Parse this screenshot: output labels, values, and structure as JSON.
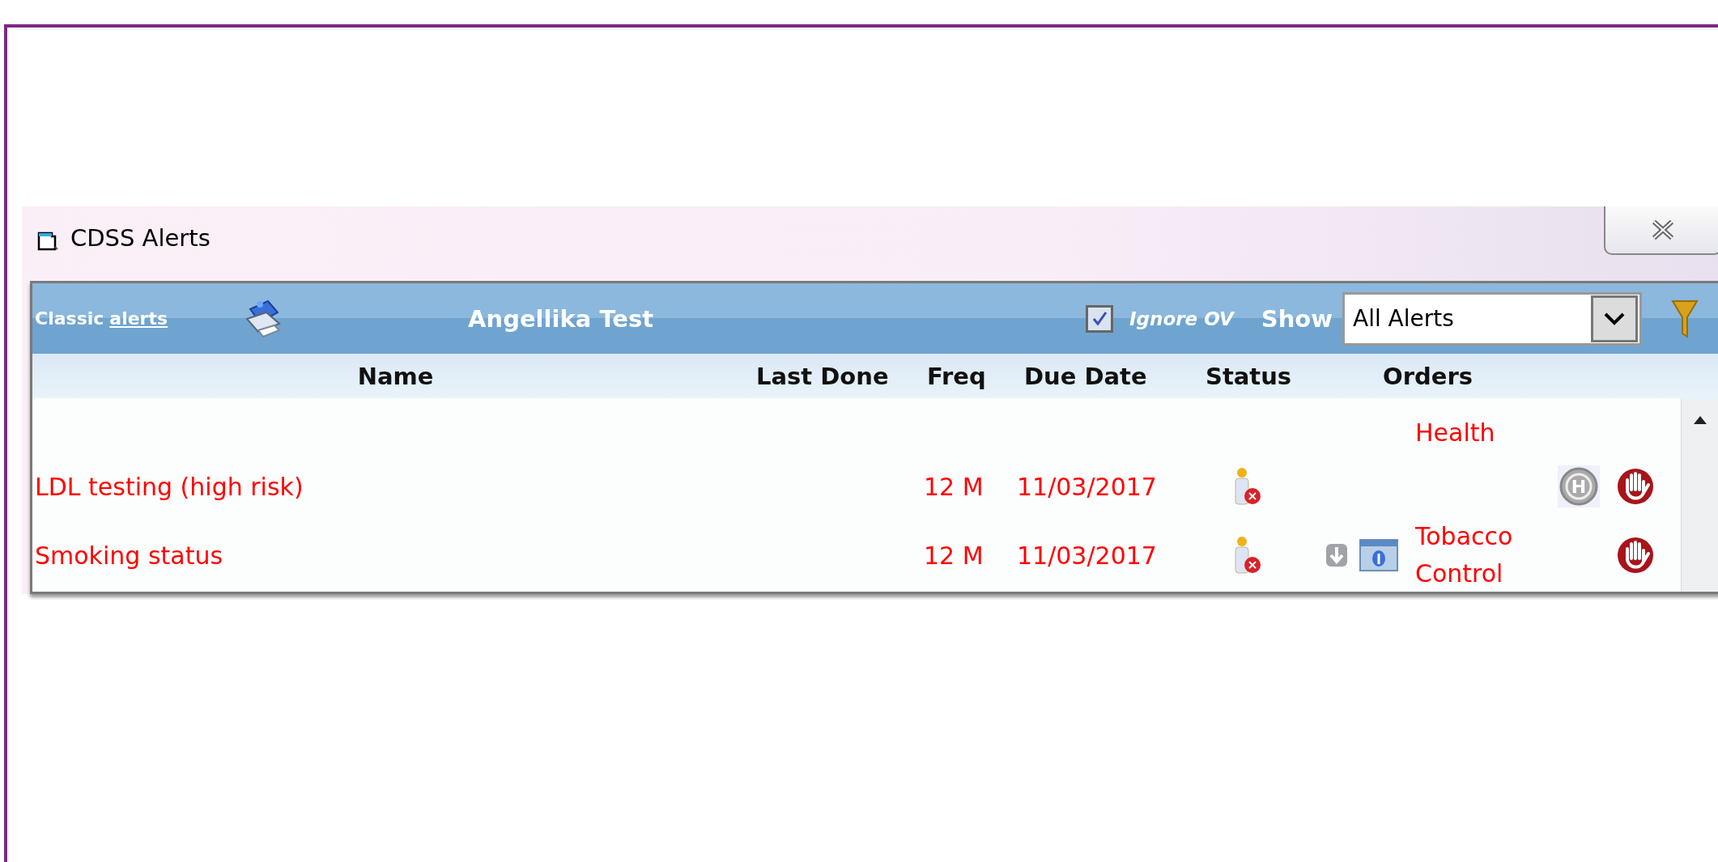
{
  "window": {
    "title": "CDSS Alerts"
  },
  "toolbar": {
    "classic_prefix": "Classic",
    "classic_link": "alerts",
    "patient": "Angellika Test",
    "ignore_ov": {
      "label": "Ignore OV",
      "checked": true
    },
    "show_label": "Show",
    "show_select": {
      "value": "All Alerts"
    }
  },
  "columns": [
    "Name",
    "Last Done",
    "Freq",
    "Due Date",
    "Status",
    "Orders"
  ],
  "rows": [
    {
      "orders": "Health"
    },
    {
      "name": "LDL testing (high risk)",
      "freq": "12 M",
      "due": "11/03/2017",
      "status": {
        "kind": "declined"
      },
      "post": [
        {
          "kind": "badge",
          "label": "H"
        },
        {
          "kind": "stop"
        }
      ]
    },
    {
      "name": "Smoking status",
      "freq": "12 M",
      "due": "11/03/2017",
      "status": {
        "kind": "declined"
      },
      "pre": [
        {
          "kind": "download"
        },
        {
          "kind": "info"
        }
      ],
      "orders": "Tobacco Control",
      "post": [
        {
          "kind": "stop"
        }
      ]
    }
  ]
}
